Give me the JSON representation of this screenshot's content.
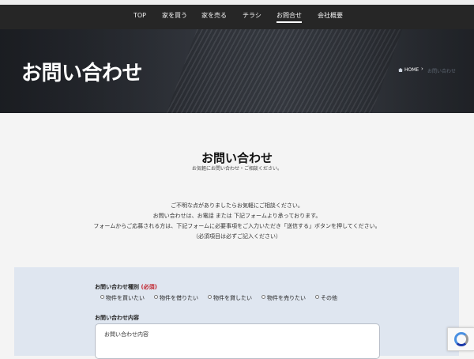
{
  "nav": {
    "items": [
      {
        "label": "TOP"
      },
      {
        "label": "家を買う"
      },
      {
        "label": "家を売る"
      },
      {
        "label": "チラシ"
      },
      {
        "label": "お問合せ",
        "active": true
      },
      {
        "label": "会社概要"
      }
    ]
  },
  "hero": {
    "title": "お問い合わせ",
    "breadcrumb": {
      "home": "HOME",
      "separator": "›",
      "current": "お問い合わせ"
    }
  },
  "section": {
    "title": "お問い合わせ",
    "subtitle": "お気軽にお問い合わせ・ご相談ください。"
  },
  "intro": {
    "lines": [
      "ご不明な点がありましたらお気軽にご相談ください。",
      "お問い合わせは、お電話 または 下記フォームより承っております。",
      "フォームからご応募される方は、下記フォームに必要事項をご入力いただき「送信する」ボタンを押してください。",
      "（必須項目は必ずご記入ください）"
    ]
  },
  "form": {
    "type_label": "お問い合わせ種別",
    "required_mark": "(必須)",
    "options": [
      "物件を買いたい",
      "物件を借りたい",
      "物件を貸したい",
      "物件を売りたい",
      "その他"
    ],
    "content_label": "お問い合わせ内容",
    "content_placeholder": "お問い合わせ内容"
  },
  "colors": {
    "nav_bg": "#262626",
    "form_bg": "#dfe6f0",
    "required": "#c0222b",
    "recaptcha_blue": "#4a90e2"
  }
}
